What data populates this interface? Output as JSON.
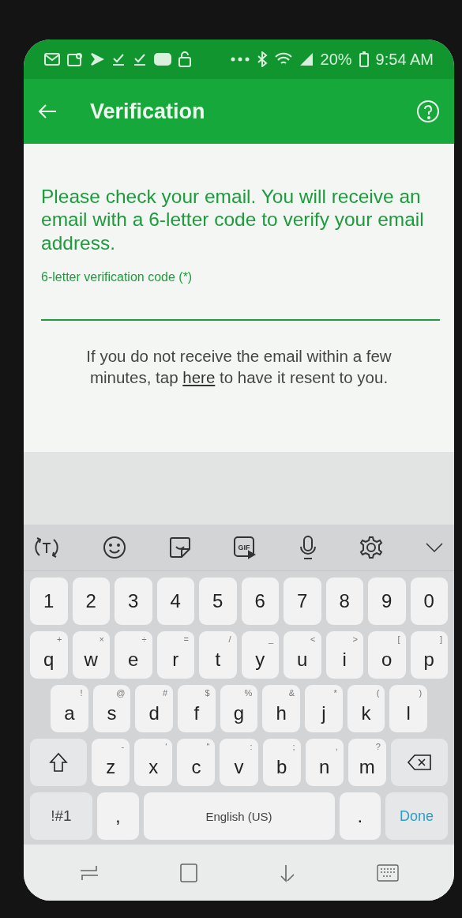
{
  "status_bar": {
    "battery": "20%",
    "time": "9:54 AM"
  },
  "app_bar": {
    "title": "Verification"
  },
  "content": {
    "prompt": "Please check your email. You will receive an email with a 6-letter code to verify your email address.",
    "field": {
      "label": "6-letter verification code (*)"
    },
    "help": {
      "before": "If you do not receive the email within a few minutes, tap ",
      "link": "here",
      "after": " to have it resent to you."
    }
  },
  "keyboard": {
    "toolbar": {
      "gif_label": "GIF"
    },
    "key_rows": [
      {
        "keys": [
          {
            "kind": "char",
            "label": "1"
          },
          {
            "kind": "char",
            "label": "2"
          },
          {
            "kind": "char",
            "label": "3"
          },
          {
            "kind": "char",
            "label": "4"
          },
          {
            "kind": "char",
            "label": "5"
          },
          {
            "kind": "char",
            "label": "6"
          },
          {
            "kind": "char",
            "label": "7"
          },
          {
            "kind": "char",
            "label": "8"
          },
          {
            "kind": "char",
            "label": "9"
          },
          {
            "kind": "char",
            "label": "0"
          }
        ]
      },
      {
        "keys": [
          {
            "kind": "char",
            "label": "q",
            "hint": "+"
          },
          {
            "kind": "char",
            "label": "w",
            "hint": "×"
          },
          {
            "kind": "char",
            "label": "e",
            "hint": "÷"
          },
          {
            "kind": "char",
            "label": "r",
            "hint": "="
          },
          {
            "kind": "char",
            "label": "t",
            "hint": "/"
          },
          {
            "kind": "char",
            "label": "y",
            "hint": "_"
          },
          {
            "kind": "char",
            "label": "u",
            "hint": "<"
          },
          {
            "kind": "char",
            "label": "i",
            "hint": ">"
          },
          {
            "kind": "char",
            "label": "o",
            "hint": "["
          },
          {
            "kind": "char",
            "label": "p",
            "hint": "]"
          }
        ]
      },
      {
        "keys": [
          {
            "kind": "char",
            "label": "a",
            "hint": "!"
          },
          {
            "kind": "char",
            "label": "s",
            "hint": "@"
          },
          {
            "kind": "char",
            "label": "d",
            "hint": "#"
          },
          {
            "kind": "char",
            "label": "f",
            "hint": "$"
          },
          {
            "kind": "char",
            "label": "g",
            "hint": "%"
          },
          {
            "kind": "char",
            "label": "h",
            "hint": "&"
          },
          {
            "kind": "char",
            "label": "j",
            "hint": "*"
          },
          {
            "kind": "char",
            "label": "k",
            "hint": "("
          },
          {
            "kind": "char",
            "label": "l",
            "hint": ")"
          }
        ]
      },
      {
        "keys": [
          {
            "kind": "shift"
          },
          {
            "kind": "char",
            "label": "z",
            "hint": "-"
          },
          {
            "kind": "char",
            "label": "x",
            "hint": "'"
          },
          {
            "kind": "char",
            "label": "c",
            "hint": "\""
          },
          {
            "kind": "char",
            "label": "v",
            "hint": ":"
          },
          {
            "kind": "char",
            "label": "b",
            "hint": ";"
          },
          {
            "kind": "char",
            "label": "n",
            "hint": ","
          },
          {
            "kind": "char",
            "label": "m",
            "hint": "?"
          },
          {
            "kind": "backspace"
          }
        ]
      },
      {
        "keys": [
          {
            "kind": "symbols",
            "label": "!#1"
          },
          {
            "kind": "char",
            "label": ","
          },
          {
            "kind": "space",
            "label": "English (US)"
          },
          {
            "kind": "char",
            "label": "."
          },
          {
            "kind": "done",
            "label": "Done"
          }
        ]
      }
    ]
  }
}
